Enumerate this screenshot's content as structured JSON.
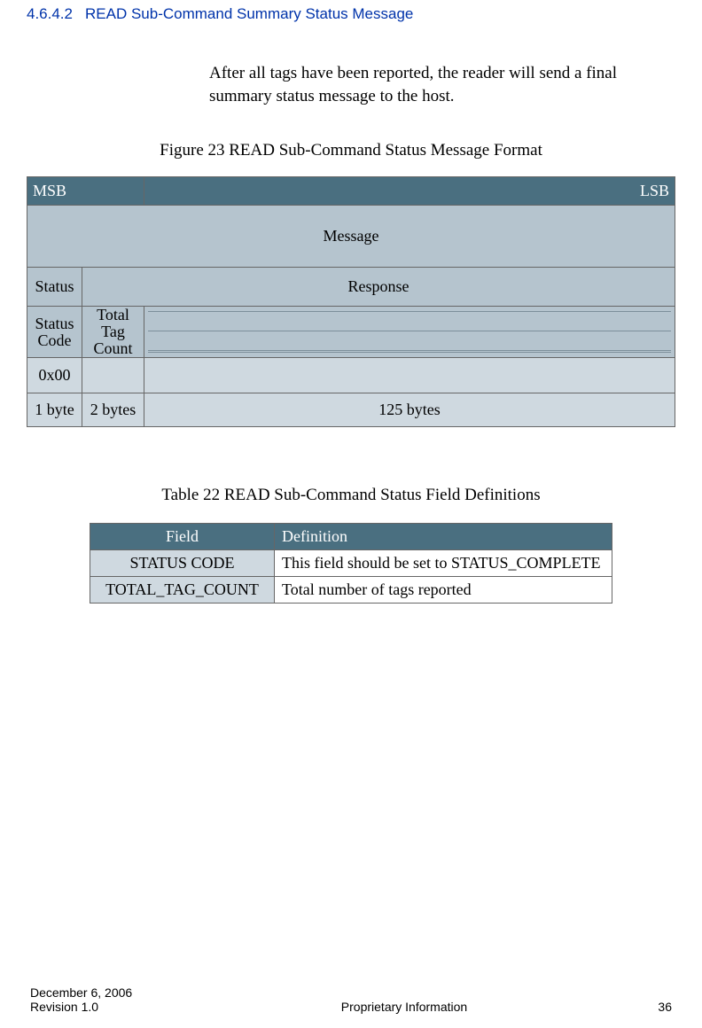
{
  "heading": {
    "number": "4.6.4.2",
    "title": "READ Sub-Command Summary Status Message"
  },
  "intro": "After all tags have been reported, the reader will send a final summary status message to the host.",
  "figure_caption": "Figure 23 READ Sub-Command Status Message Format",
  "msg_table": {
    "msb": "MSB",
    "lsb": "LSB",
    "message": "Message",
    "status": "Status",
    "response": "Response",
    "status_code": "Status\nCode",
    "total_tag_count": "Total\nTag\nCount",
    "value_0x00": "0x00",
    "bytes_col1": "1 byte",
    "bytes_col2": "2 bytes",
    "bytes_col3": "125 bytes"
  },
  "table_caption": "Table 22 READ Sub-Command Status Field Definitions",
  "def_table": {
    "h_field": "Field",
    "h_def": "Definition",
    "rows": [
      {
        "field": "STATUS CODE",
        "def": "This field should be set to STATUS_COMPLETE"
      },
      {
        "field": "TOTAL_TAG_COUNT",
        "def": "Total number of tags reported"
      }
    ]
  },
  "footer": {
    "date": "December 6, 2006",
    "revision": "Revision 1.0",
    "center": "Proprietary Information",
    "page": "36"
  }
}
